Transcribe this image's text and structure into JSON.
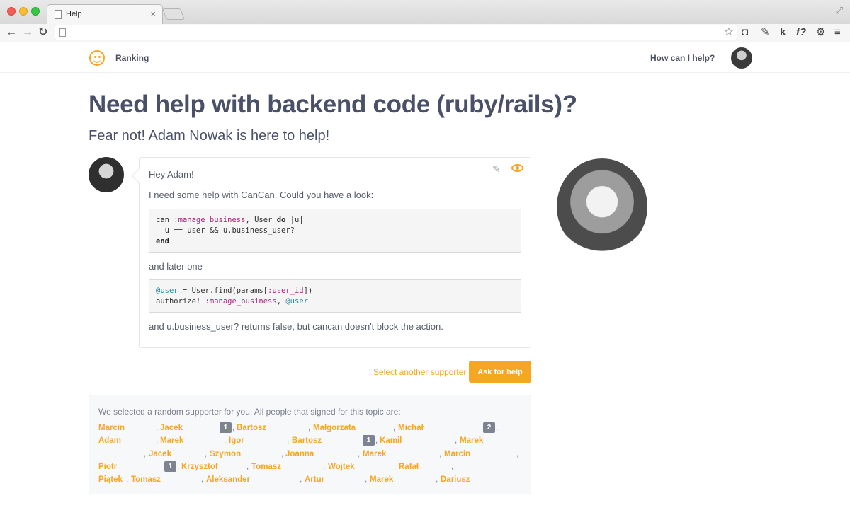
{
  "browser": {
    "tab_title": "Help",
    "tab_close": "×",
    "address_value": "",
    "extensions": [
      "pocket-icon",
      "wrench-icon",
      "k",
      "f?",
      "gear-icon",
      "menu-icon"
    ],
    "ext_k": "k",
    "ext_f": "f?"
  },
  "nav": {
    "ranking": "Ranking",
    "help": "How can I help?"
  },
  "page": {
    "title": "Need help with backend code (ruby/rails)?",
    "subtitle": "Fear not! Adam Nowak is here to help!"
  },
  "message": {
    "greeting": "Hey Adam!",
    "line1": "I need some help with CanCan. Could you have a look:",
    "code1": [
      "can :manage_business, User do |u|",
      "  u == user && u.business_user?",
      "end"
    ],
    "middle": "and later one",
    "code2": [
      "@user = User.find(params[:user_id])",
      "authorize! :manage_business, @user"
    ],
    "closing": "and u.business_user? returns false, but cancan doesn't block the action."
  },
  "actions": {
    "select_another": "Select another supporter",
    "ask": "Ask for help"
  },
  "supporters": {
    "intro": "We selected a random supporter for you. All people that signed for this topic are:",
    "names": [
      "Marcin",
      "Jacek",
      "Bartosz",
      "Małgorzata",
      "Michał",
      "Adam",
      "Marek",
      "Igor",
      "Bartosz",
      "Kamil",
      "Marek",
      "Jacek",
      "Szymon",
      "Joanna",
      "Marek",
      "Marcin",
      "Piotr",
      "Krzysztof",
      "Tomasz",
      "Wojtek",
      "Rafał",
      "Piątek",
      "Tomasz",
      "Aleksander",
      "Artur",
      "Marek",
      "Dariusz"
    ],
    "badges": [
      "1",
      "2",
      "1",
      "1"
    ]
  }
}
